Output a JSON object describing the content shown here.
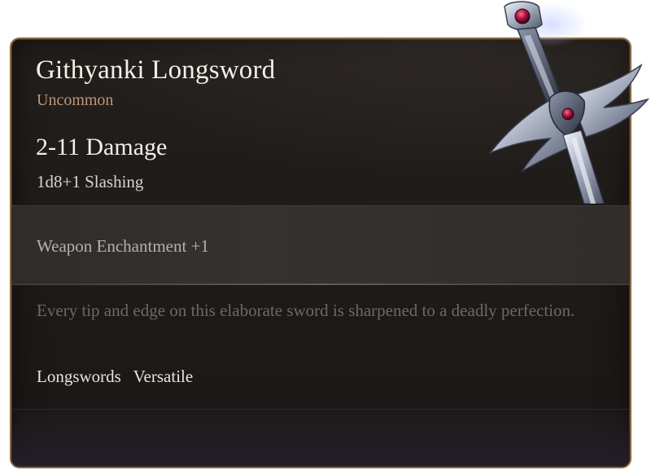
{
  "item": {
    "name": "Githyanki Longsword",
    "rarity": "Uncommon",
    "damage": "2-11 Damage",
    "damage_detail": "1d8+1 Slashing",
    "enchantment": "Weapon Enchantment +1",
    "description": "Every tip and edge on this elaborate sword is sharpened to a deadly perfection.",
    "tags": [
      "Longswords",
      "Versatile"
    ],
    "icon": "githyanki-longsword-icon"
  },
  "colors": {
    "rarity": "#c0957a",
    "border": "#8a6a43",
    "background": "#1e1b19"
  }
}
